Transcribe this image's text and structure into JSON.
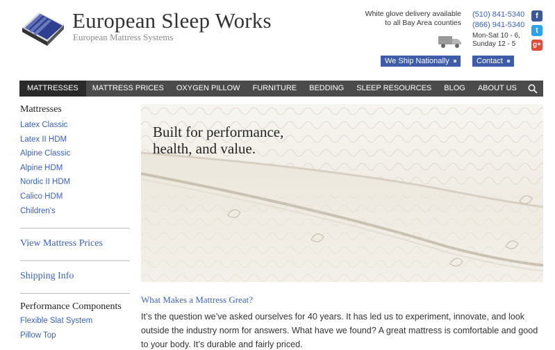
{
  "brand": {
    "title": "European Sleep Works",
    "subtitle": "European Mattress Systems"
  },
  "header": {
    "delivery_line1": "White glove delivery available",
    "delivery_line2": "to all Bay Area counties",
    "phone1": "(510) 841-5340",
    "phone2": "(866) 941-5340",
    "hours_line1": "Mon-Sat 10 - 6,",
    "hours_line2": "Sunday 12 - 5",
    "ship_label": "We Ship Nationally",
    "contact_label": "Contact"
  },
  "social": {
    "facebook": "f",
    "twitter": "t",
    "google": "g+"
  },
  "nav": {
    "items": [
      "MATTRESSES",
      "MATTRESS PRICES",
      "OXYGEN PILLOW",
      "FURNITURE",
      "BEDDING",
      "SLEEP RESOURCES",
      "BLOG",
      "ABOUT US"
    ],
    "active_index": 0
  },
  "sidebar": {
    "heading": "Mattresses",
    "links": [
      "Latex Classic",
      "Latex II HDM",
      "Alpine Classic",
      "Alpine HDM",
      "Nordic II HDM",
      "Calico HDM",
      "Children's"
    ],
    "prices_link": "View Mattress Prices",
    "shipping_link": "Shipping Info",
    "components_heading": "Performance Components",
    "components": [
      "Flexible Slat System",
      "Pillow Top"
    ]
  },
  "hero": {
    "line1": "Built for performance,",
    "line2": "health, and value."
  },
  "article": {
    "title": "What Makes a Mattress Great?",
    "body": "It’s the question we’ve asked ourselves for 40 years. It has led us to experiment, innovate, and look outside the industry norm for answers. What have we found? A great mattress is comfortable and good to your body. It’s durable and fairly priced."
  },
  "colors": {
    "link": "#3c63b5",
    "nav_bg": "#4b4b4b",
    "nav_active": "#2a2a2a",
    "pill_bg": "#3f5ca8"
  }
}
